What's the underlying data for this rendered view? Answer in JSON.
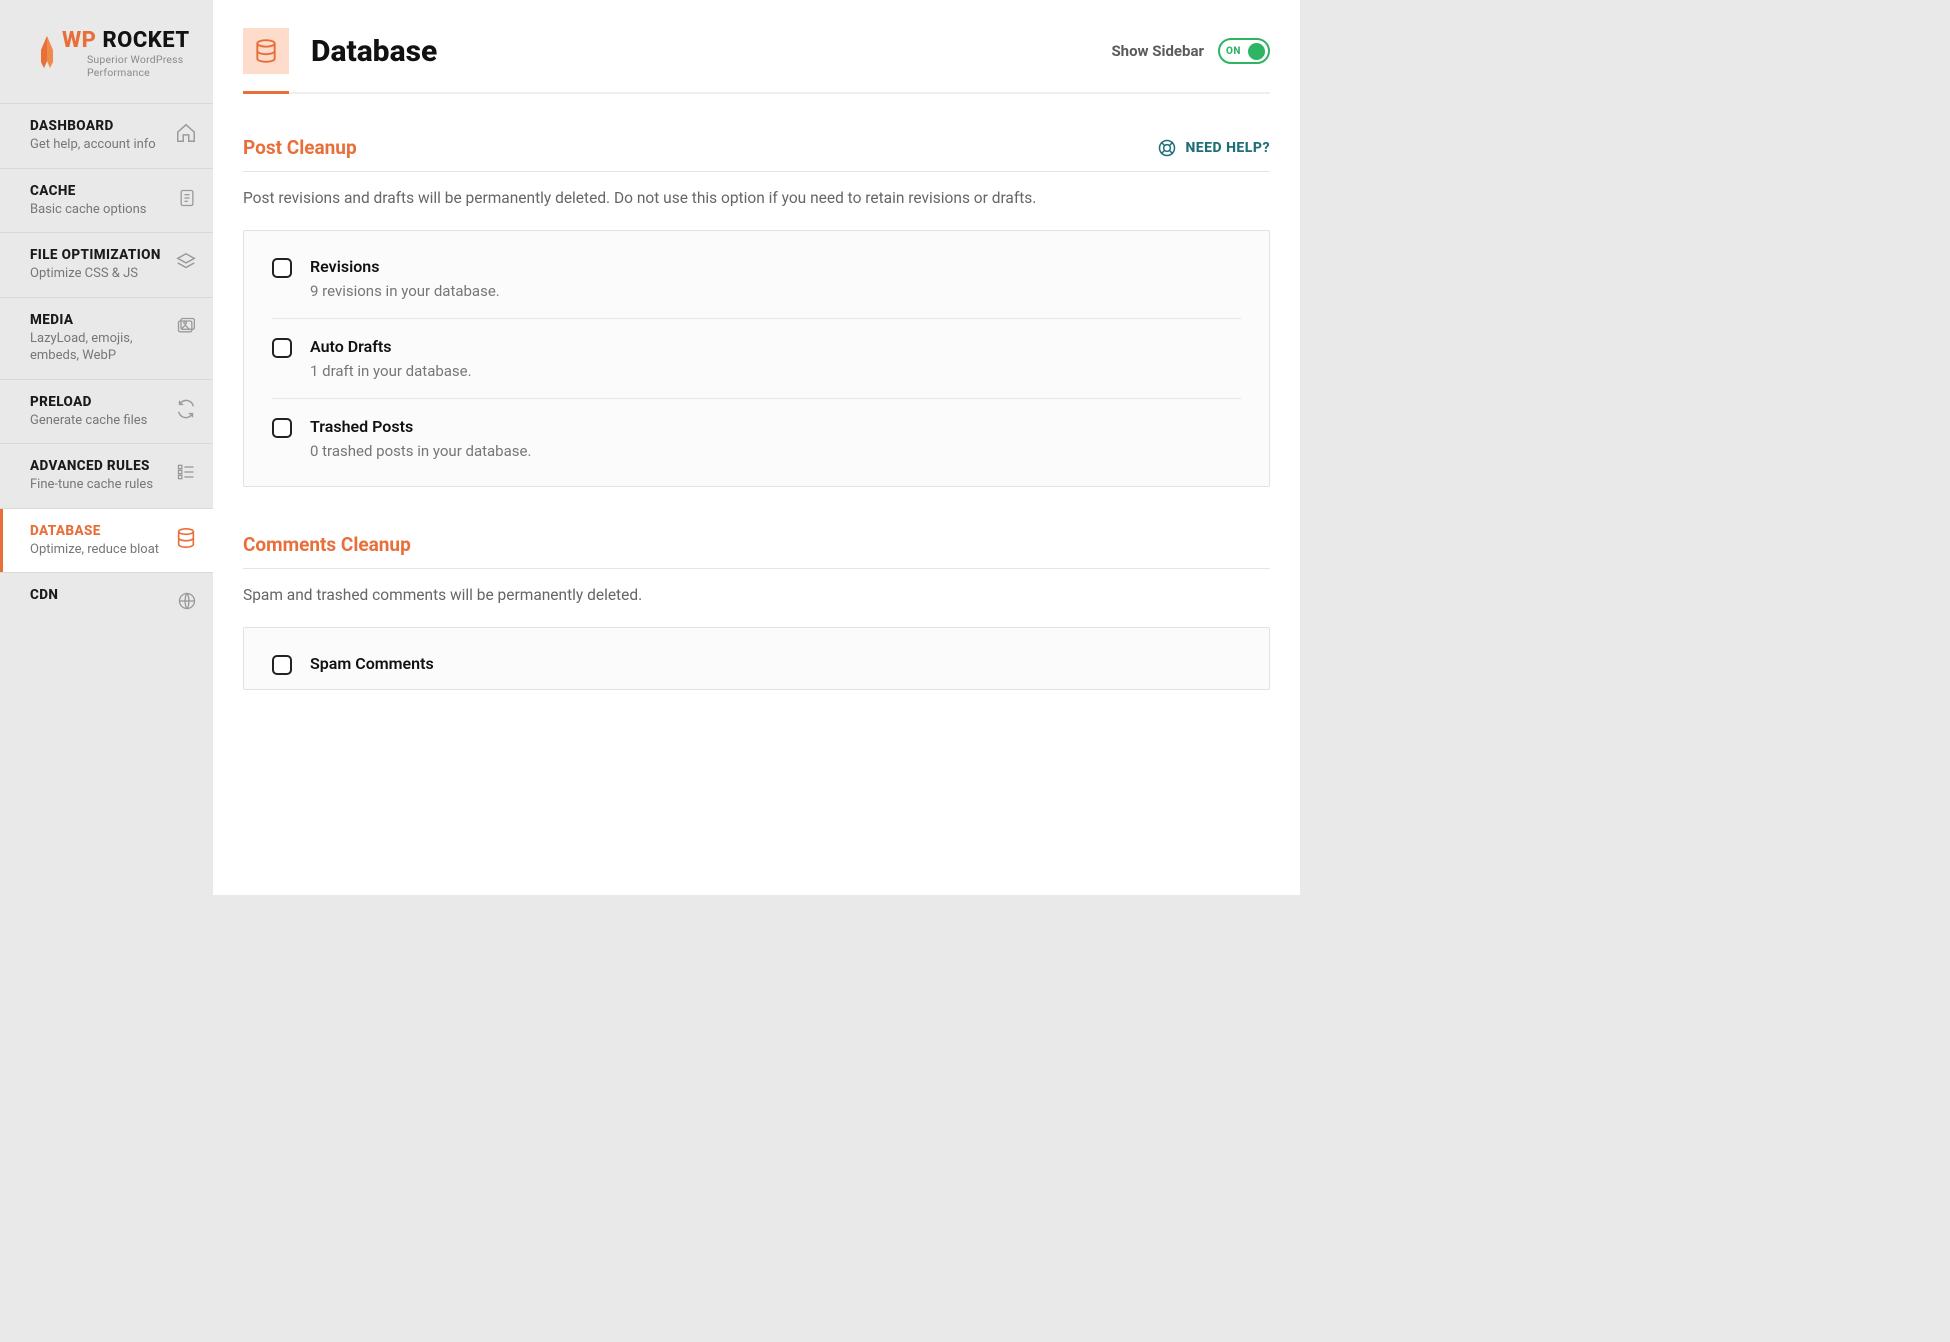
{
  "brand": {
    "wp": "WP",
    "rocket": "ROCKET",
    "tagline": "Superior WordPress Performance"
  },
  "sidebar": {
    "items": [
      {
        "title": "DASHBOARD",
        "sub": "Get help, account info",
        "icon": "home",
        "active": false
      },
      {
        "title": "CACHE",
        "sub": "Basic cache options",
        "icon": "doc",
        "active": false
      },
      {
        "title": "FILE OPTIMIZATION",
        "sub": "Optimize CSS & JS",
        "icon": "layers",
        "active": false
      },
      {
        "title": "MEDIA",
        "sub": "LazyLoad, emojis, embeds, WebP",
        "icon": "images",
        "active": false
      },
      {
        "title": "PRELOAD",
        "sub": "Generate cache files",
        "icon": "refresh",
        "active": false
      },
      {
        "title": "ADVANCED RULES",
        "sub": "Fine-tune cache rules",
        "icon": "list",
        "active": false
      },
      {
        "title": "DATABASE",
        "sub": "Optimize, reduce bloat",
        "icon": "database",
        "active": true
      },
      {
        "title": "CDN",
        "sub": "",
        "icon": "globe",
        "active": false
      }
    ]
  },
  "header": {
    "title": "Database",
    "show_sidebar_label": "Show Sidebar",
    "toggle_text": "ON"
  },
  "help": {
    "label": "NEED HELP?"
  },
  "sections": [
    {
      "title": "Post Cleanup",
      "desc": "Post revisions and drafts will be permanently deleted. Do not use this option if you need to retain revisions or drafts.",
      "options": [
        {
          "label": "Revisions",
          "sub": "9 revisions in your database."
        },
        {
          "label": "Auto Drafts",
          "sub": "1 draft in your database."
        },
        {
          "label": "Trashed Posts",
          "sub": "0 trashed posts in your database."
        }
      ]
    },
    {
      "title": "Comments Cleanup",
      "desc": "Spam and trashed comments will be permanently deleted.",
      "options": [
        {
          "label": "Spam Comments",
          "sub": ""
        }
      ]
    }
  ]
}
